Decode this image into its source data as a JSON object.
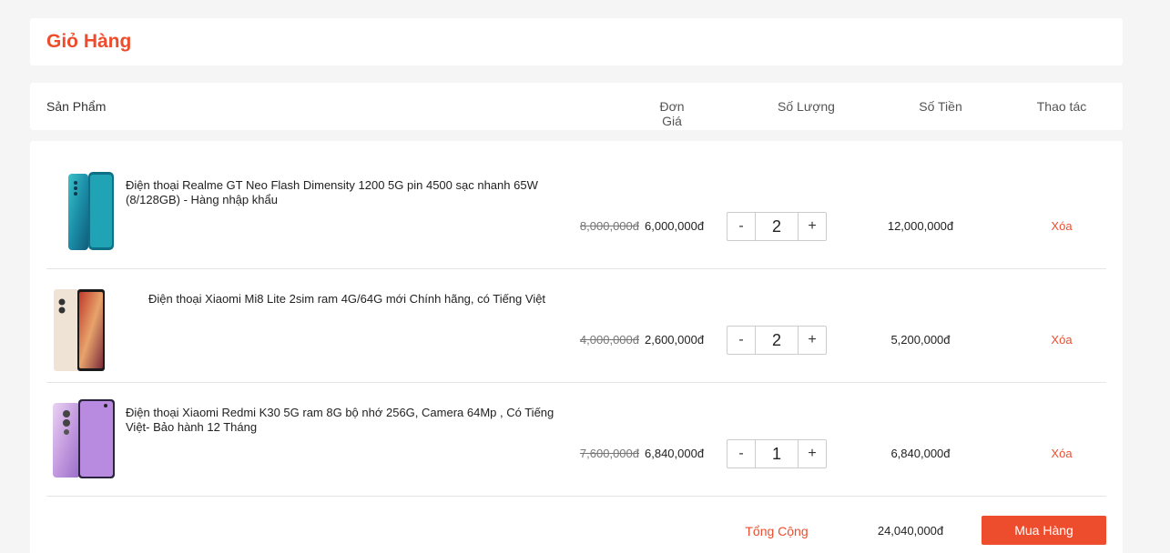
{
  "page": {
    "title": "Giỏ Hàng"
  },
  "header": {
    "product": "Sản Phẩm",
    "price": "Đơn Giá",
    "quantity": "Số Lượng",
    "total": "Số Tiền",
    "action": "Thao tác"
  },
  "items": [
    {
      "name": "Điện thoại Realme GT Neo Flash Dimensity 1200 5G pin 4500 sạc nhanh 65W (8/128GB) - Hàng nhập khẩu",
      "old_price": "8,000,000đ",
      "price": "6,000,000đ",
      "qty_minus": "-",
      "qty": "2",
      "qty_plus": "+",
      "total": "12,000,000đ",
      "delete": "Xóa"
    },
    {
      "name": "Điện thoại Xiaomi Mi8 Lite 2sim ram 4G/64G mới Chính hãng, có Tiếng Việt",
      "old_price": "4,000,000đ",
      "price": "2,600,000đ",
      "qty_minus": "-",
      "qty": "2",
      "qty_plus": "+",
      "total": "5,200,000đ",
      "delete": "Xóa"
    },
    {
      "name": "Điện thoại Xiaomi Redmi K30 5G ram 8G bộ nhớ 256G, Camera 64Mp , Có Tiếng Việt- Bảo hành 12 Tháng",
      "old_price": "7,600,000đ",
      "price": "6,840,000đ",
      "qty_minus": "-",
      "qty": "1",
      "qty_plus": "+",
      "total": "6,840,000đ",
      "delete": "Xóa"
    }
  ],
  "summary": {
    "label": "Tổng Cộng",
    "value": "24,040,000đ",
    "buy_button": "Mua Hàng"
  },
  "colors": {
    "accent": "#ee4d2d"
  }
}
